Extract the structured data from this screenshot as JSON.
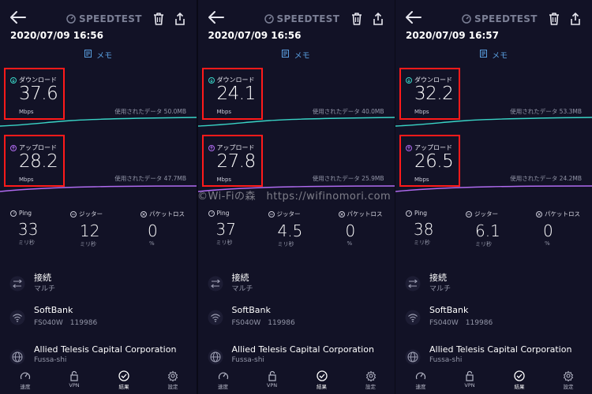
{
  "header": {
    "brand": "SPEEDTEST"
  },
  "labels": {
    "memo": "メモ",
    "download": "ダウンロード",
    "upload": "アップロード",
    "mbps": "Mbps",
    "used_prefix": "使用されたデータ",
    "ping": "Ping",
    "jitter": "ジッター",
    "packet_loss": "パケットロス",
    "ms": "ミリ秒",
    "percent": "%"
  },
  "nav": {
    "speed": "速度",
    "vpn": "VPN",
    "results": "結果",
    "settings": "設定"
  },
  "watermark": "©Wi-Fiの森　https://wifinomori.com",
  "panels": [
    {
      "date": "2020/07/09 16:56",
      "download": "37.6",
      "download_used": "50.0MB",
      "upload": "28.2",
      "upload_used": "47.7MB",
      "ping": "33",
      "jitter": "12",
      "loss": "0",
      "connection_title": "接続",
      "connection_sub": "マルチ",
      "carrier": "SoftBank",
      "device": "FS040W　119986",
      "server": "Allied Telesis Capital Corporation",
      "server_city": "Fussa-shi"
    },
    {
      "date": "2020/07/09 16:56",
      "download": "24.1",
      "download_used": "40.0MB",
      "upload": "27.8",
      "upload_used": "25.9MB",
      "ping": "37",
      "jitter": "4.5",
      "loss": "0",
      "connection_title": "接続",
      "connection_sub": "マルチ",
      "carrier": "SoftBank",
      "device": "FS040W　119986",
      "server": "Allied Telesis Capital Corporation",
      "server_city": "Fussa-shi"
    },
    {
      "date": "2020/07/09 16:57",
      "download": "32.2",
      "download_used": "53.3MB",
      "upload": "26.5",
      "upload_used": "24.2MB",
      "ping": "38",
      "jitter": "6.1",
      "loss": "0",
      "connection_title": "接続",
      "connection_sub": "マルチ",
      "carrier": "SoftBank",
      "device": "FS040W　119986",
      "server": "Allied Telesis Capital Corporation",
      "server_city": "Fussa-shi"
    }
  ],
  "colors": {
    "download": "#39d4c6",
    "upload": "#b06bf0",
    "highlight": "#ff1a1a",
    "memo": "#5a9fe0"
  },
  "icons": [
    "back-arrow-icon",
    "speedometer-icon",
    "trash-icon",
    "share-icon",
    "memo-icon",
    "download-icon",
    "upload-icon",
    "ping-icon",
    "jitter-icon",
    "packet-loss-icon",
    "connection-icon",
    "wifi-icon",
    "globe-icon",
    "gauge-nav-icon",
    "lock-icon",
    "check-circle-icon",
    "gear-icon"
  ]
}
